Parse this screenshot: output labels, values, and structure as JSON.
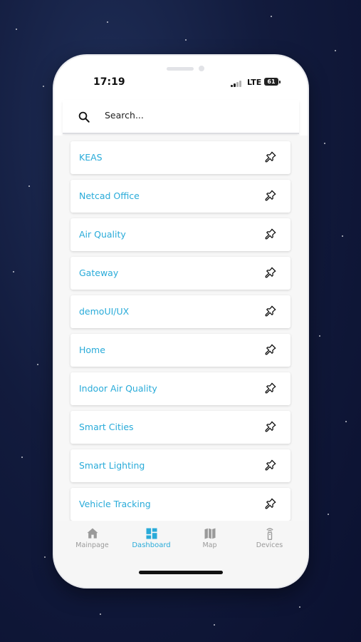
{
  "status_bar": {
    "time": "17:19",
    "network": "LTE",
    "battery": "61"
  },
  "search": {
    "placeholder": "Search..."
  },
  "dashboards": [
    {
      "label": "KEAS",
      "icon": "pin-icon"
    },
    {
      "label": "Netcad Office",
      "icon": "pin-icon"
    },
    {
      "label": "Air Quality",
      "icon": "pin-icon"
    },
    {
      "label": "Gateway",
      "icon": "pin-icon"
    },
    {
      "label": "demoUI/UX",
      "icon": "pin-icon"
    },
    {
      "label": "Home",
      "icon": "pin-icon"
    },
    {
      "label": "Indoor Air Quality",
      "icon": "pin-icon"
    },
    {
      "label": "Smart Cities",
      "icon": "pin-icon"
    },
    {
      "label": "Smart Lighting",
      "icon": "pin-icon"
    },
    {
      "label": "Vehicle Tracking",
      "icon": "pin-icon"
    }
  ],
  "tabs": [
    {
      "label": "Mainpage",
      "icon": "home-icon",
      "active": false
    },
    {
      "label": "Dashboard",
      "icon": "dashboard-icon",
      "active": true
    },
    {
      "label": "Map",
      "icon": "map-icon",
      "active": false
    },
    {
      "label": "Devices",
      "icon": "device-icon",
      "active": false
    }
  ],
  "colors": {
    "accent": "#29abd9",
    "inactive": "#9a9a9a",
    "background": "#f7f7f7"
  }
}
